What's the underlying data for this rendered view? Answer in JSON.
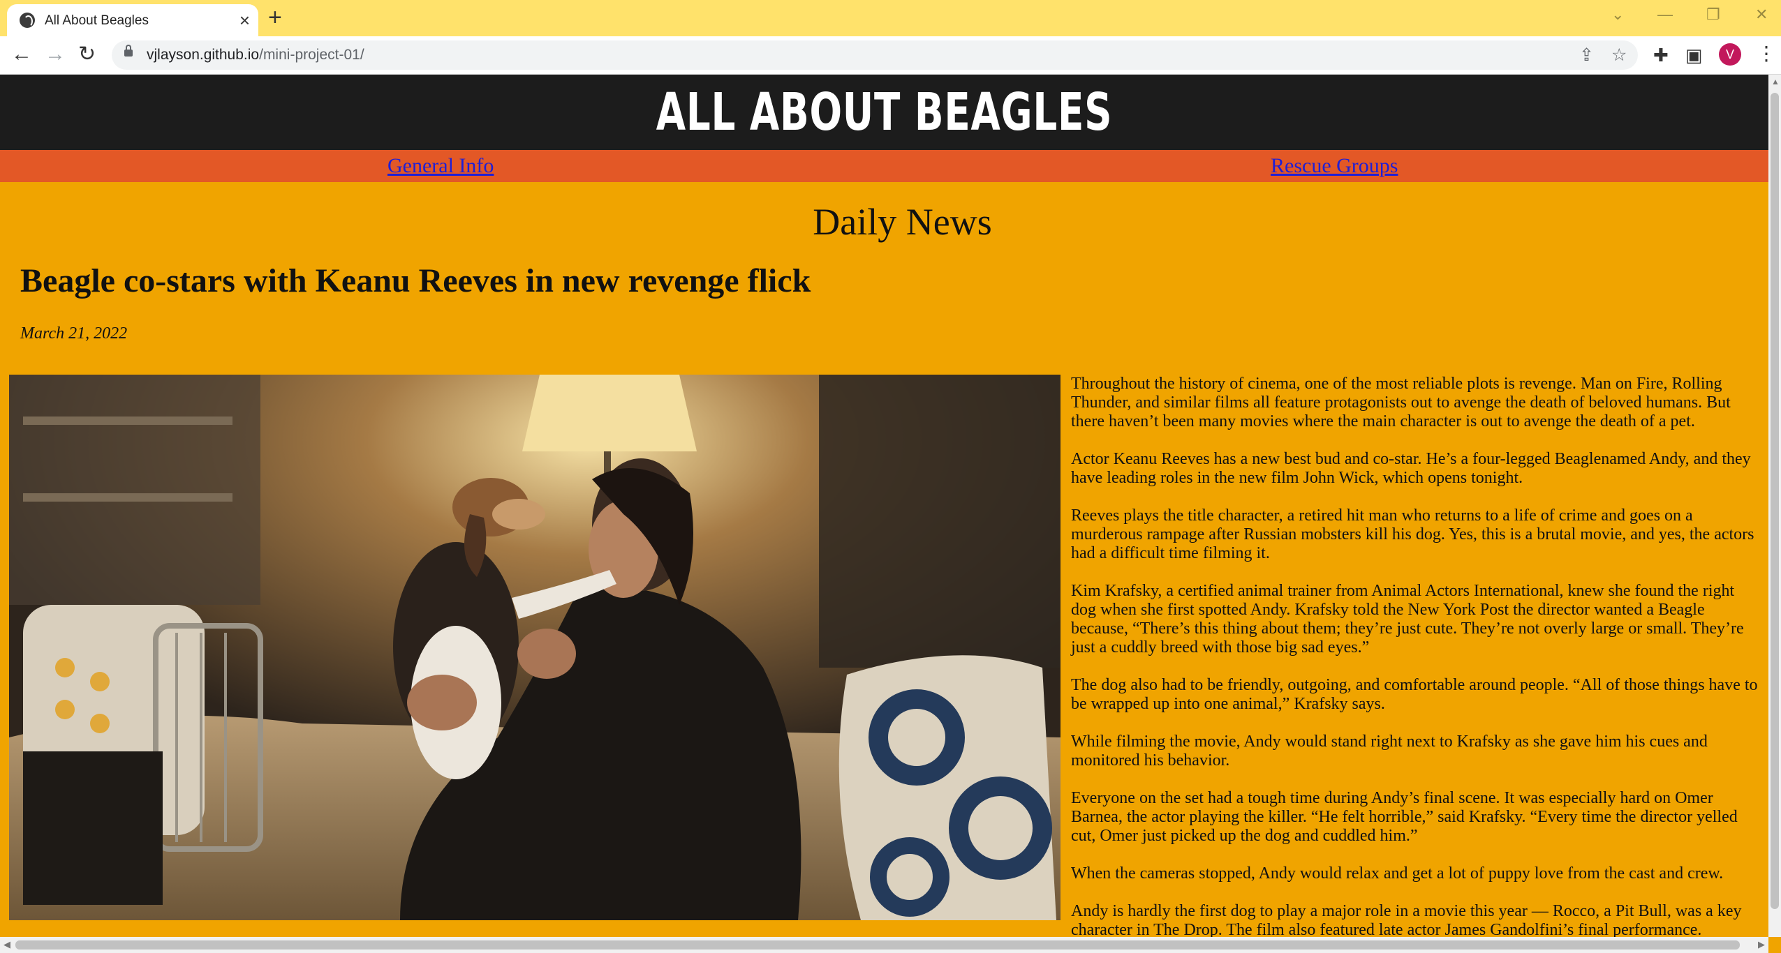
{
  "browser": {
    "tab_title": "All About Beagles",
    "url_host": "vjlayson.github.io",
    "url_path": "/mini-project-01/",
    "profile_initial": "V",
    "icons": {
      "favicon": "globe-icon",
      "close": "close-icon",
      "new_tab": "plus-icon",
      "back": "back-arrow-icon",
      "forward": "forward-arrow-icon",
      "reload": "reload-icon",
      "lock": "lock-icon",
      "share": "share-icon",
      "bookmark": "star-icon",
      "extensions": "puzzle-icon",
      "side_panel": "side-panel-icon",
      "menu": "kebab-menu-icon"
    },
    "colors": {
      "tabbar": "#ffe26b",
      "avatar": "#c2185b"
    }
  },
  "site": {
    "title": "ALL ABOUT BEAGLES",
    "nav": [
      {
        "label": "General Info"
      },
      {
        "label": "Rescue Groups"
      }
    ],
    "section_title": "Daily News",
    "colors": {
      "header_bg": "#1c1c1c",
      "nav_bg": "#e35826",
      "page_bg": "#f0a400",
      "link": "#1f1fd6"
    }
  },
  "article": {
    "headline": "Beagle co-stars with Keanu Reeves in new revenge flick",
    "date": "March 21, 2022",
    "image_alt": "Keanu Reeves holding a beagle puppy on a couch",
    "paragraphs": [
      "Throughout the history of cinema, one of the most reliable plots is revenge. Man on Fire, Rolling Thunder, and similar films all feature protagonists out to avenge the death of beloved humans. But there haven’t been many movies where the main character is out to avenge the death of a pet.",
      "Actor Keanu Reeves has a new best bud and co-star. He’s a four-legged Beaglenamed Andy, and they have leading roles in the new film John Wick, which opens tonight.",
      "Reeves plays the title character, a retired hit man who returns to a life of crime and goes on a murderous rampage after Russian mobsters kill his dog. Yes, this is a brutal movie, and yes, the actors had a difficult time filming it.",
      "Kim Krafsky, a certified animal trainer from Animal Actors International, knew she found the right dog when she first spotted Andy. Krafsky told the New York Post the director wanted a Beagle because, “There’s this thing about them; they’re just cute. They’re not overly large or small. They’re just a cuddly breed with those big sad eyes.”",
      "The dog also had to be friendly, outgoing, and comfortable around people. “All of those things have to be wrapped up into one animal,” Krafsky says.",
      "While filming the movie, Andy would stand right next to Krafsky as she gave him his cues and monitored his behavior.",
      "Everyone on the set had a tough time during Andy’s final scene. It was especially hard on Omer Barnea, the actor playing the killer. “He felt horrible,” said Krafsky. “Every time the director yelled cut, Omer just picked up the dog and cuddled him.”",
      "When the cameras stopped, Andy would relax and get a lot of puppy love from the cast and crew.",
      "Andy is hardly the first dog to play a major role in a movie this year — Rocco, a Pit Bull, was a key character in The Drop. The film also featured late actor James Gandolfini’s final performance."
    ]
  }
}
